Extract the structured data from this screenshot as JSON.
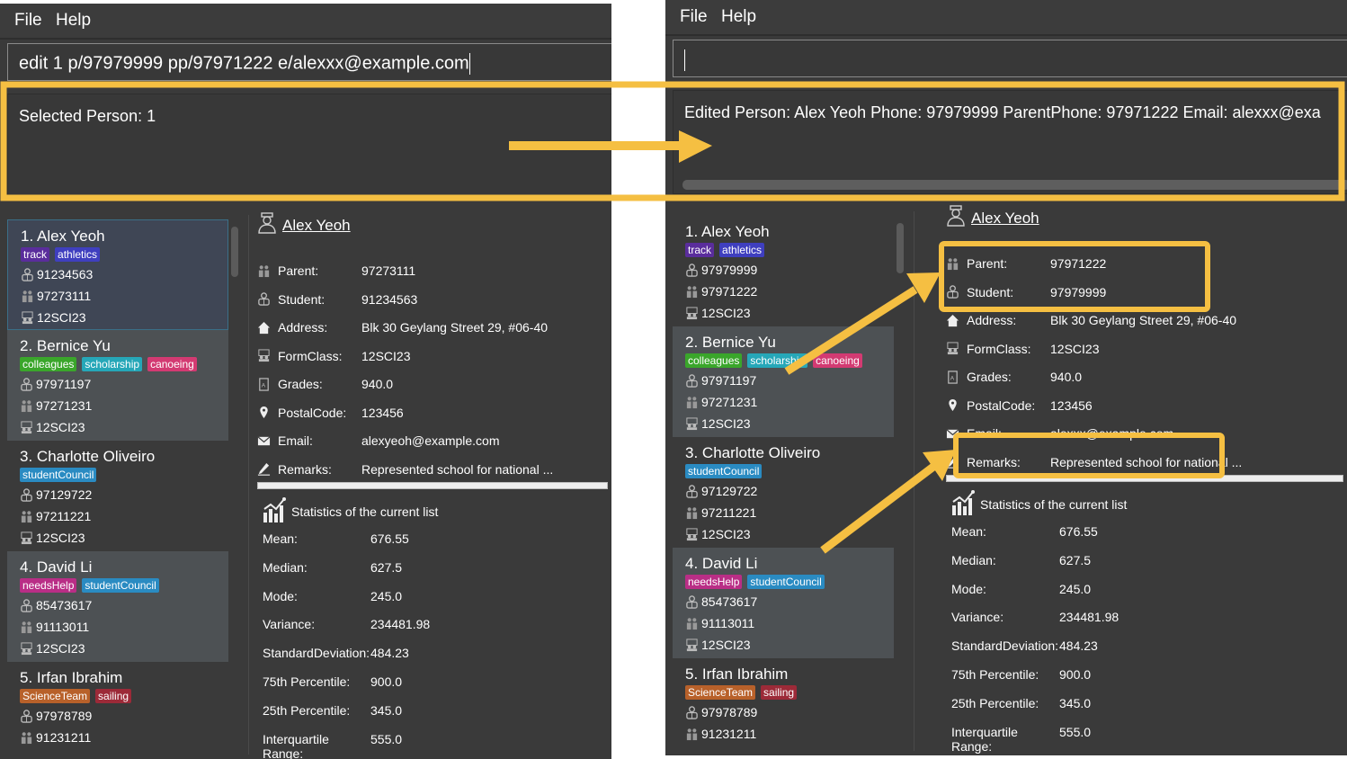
{
  "panels": [
    {
      "menu": [
        "File",
        "Help"
      ],
      "command": "edit 1 p/97979999 pp/97971222 e/alexxx@example.com",
      "result": "Selected Person: 1",
      "persons": [
        {
          "index": "1.",
          "name": "Alex Yeoh",
          "tags": [
            {
              "t": "track",
              "c": "#5a2d9c"
            },
            {
              "t": "athletics",
              "c": "#3f3fbf"
            }
          ],
          "student": "91234563",
          "parent": "97273111",
          "formclass": "12SCI23"
        },
        {
          "index": "2.",
          "name": "Bernice Yu",
          "tags": [
            {
              "t": "colleagues",
              "c": "#3aa62b"
            },
            {
              "t": "scholarship",
              "c": "#26a7b8"
            },
            {
              "t": "canoeing",
              "c": "#d33a72"
            }
          ],
          "student": "97971197",
          "parent": "97271231",
          "formclass": "12SCI23"
        },
        {
          "index": "3.",
          "name": "Charlotte Oliveiro",
          "tags": [
            {
              "t": "studentCouncil",
              "c": "#2a8bc2"
            }
          ],
          "student": "97129722",
          "parent": "97211221",
          "formclass": "12SCI23"
        },
        {
          "index": "4.",
          "name": "David Li",
          "tags": [
            {
              "t": "needsHelp",
              "c": "#b92e86"
            },
            {
              "t": "studentCouncil",
              "c": "#2a8bc2"
            }
          ],
          "student": "85473617",
          "parent": "91113011",
          "formclass": "12SCI23"
        },
        {
          "index": "5.",
          "name": "Irfan Ibrahim",
          "tags": [
            {
              "t": "ScienceTeam",
              "c": "#b8612a"
            },
            {
              "t": "sailing",
              "c": "#9c2a38"
            }
          ],
          "student": "97978789",
          "parent": "91231211",
          "formclass": ""
        }
      ],
      "detail": {
        "name": "Alex Yeoh",
        "rows": [
          {
            "label": "Parent:",
            "value": "97273111",
            "icon": "parent-icon"
          },
          {
            "label": "Student:",
            "value": "91234563",
            "icon": "student-icon"
          },
          {
            "label": "Address:",
            "value": "Blk 30 Geylang Street 29, #06-40",
            "icon": "home-icon"
          },
          {
            "label": "FormClass:",
            "value": "12SCI23",
            "icon": "class-icon"
          },
          {
            "label": "Grades:",
            "value": "940.0",
            "icon": "grades-icon"
          },
          {
            "label": "PostalCode:",
            "value": "123456",
            "icon": "pin-icon"
          },
          {
            "label": "Email:",
            "value": "alexyeoh@example.com",
            "icon": "email-icon"
          },
          {
            "label": "Remarks:",
            "value": "Represented school for national ...",
            "icon": "pencil-icon"
          }
        ]
      },
      "stats": {
        "title": "Statistics of the current list",
        "rows": [
          {
            "label": "Mean:",
            "value": "676.55"
          },
          {
            "label": "Median:",
            "value": "627.5"
          },
          {
            "label": "Mode:",
            "value": "245.0"
          },
          {
            "label": "Variance:",
            "value": "234481.98"
          },
          {
            "label": "StandardDeviation:",
            "value": "484.23"
          },
          {
            "label": "75th Percentile:",
            "value": "900.0"
          },
          {
            "label": "25th Percentile:",
            "value": "345.0"
          },
          {
            "label": "Interquartile Range:",
            "value": "555.0"
          }
        ]
      }
    },
    {
      "menu": [
        "File",
        "Help"
      ],
      "command": "",
      "result": "Edited Person: Alex Yeoh Phone: 97979999 ParentPhone: 97971222 Email: alexxx@exa",
      "persons": [
        {
          "index": "1.",
          "name": "Alex Yeoh",
          "tags": [
            {
              "t": "track",
              "c": "#5a2d9c"
            },
            {
              "t": "athletics",
              "c": "#3f3fbf"
            }
          ],
          "student": "97979999",
          "parent": "97971222",
          "formclass": "12SCI23"
        },
        {
          "index": "2.",
          "name": "Bernice Yu",
          "tags": [
            {
              "t": "colleagues",
              "c": "#3aa62b"
            },
            {
              "t": "scholarship",
              "c": "#26a7b8"
            },
            {
              "t": "canoeing",
              "c": "#d33a72"
            }
          ],
          "student": "97971197",
          "parent": "97271231",
          "formclass": "12SCI23"
        },
        {
          "index": "3.",
          "name": "Charlotte Oliveiro",
          "tags": [
            {
              "t": "studentCouncil",
              "c": "#2a8bc2"
            }
          ],
          "student": "97129722",
          "parent": "97211221",
          "formclass": "12SCI23"
        },
        {
          "index": "4.",
          "name": "David Li",
          "tags": [
            {
              "t": "needsHelp",
              "c": "#b92e86"
            },
            {
              "t": "studentCouncil",
              "c": "#2a8bc2"
            }
          ],
          "student": "85473617",
          "parent": "91113011",
          "formclass": "12SCI23"
        },
        {
          "index": "5.",
          "name": "Irfan Ibrahim",
          "tags": [
            {
              "t": "ScienceTeam",
              "c": "#b8612a"
            },
            {
              "t": "sailing",
              "c": "#9c2a38"
            }
          ],
          "student": "97978789",
          "parent": "91231211",
          "formclass": ""
        }
      ],
      "detail": {
        "name": "Alex Yeoh",
        "rows": [
          {
            "label": "Parent:",
            "value": "97971222",
            "icon": "parent-icon"
          },
          {
            "label": "Student:",
            "value": "97979999",
            "icon": "student-icon"
          },
          {
            "label": "Address:",
            "value": "Blk 30 Geylang Street 29, #06-40",
            "icon": "home-icon"
          },
          {
            "label": "FormClass:",
            "value": "12SCI23",
            "icon": "class-icon"
          },
          {
            "label": "Grades:",
            "value": "940.0",
            "icon": "grades-icon"
          },
          {
            "label": "PostalCode:",
            "value": "123456",
            "icon": "pin-icon"
          },
          {
            "label": "Email:",
            "value": "alexxx@example.com",
            "icon": "email-icon"
          },
          {
            "label": "Remarks:",
            "value": "Represented school for national ...",
            "icon": "pencil-icon"
          }
        ]
      },
      "stats": {
        "title": "Statistics of the current list",
        "rows": [
          {
            "label": "Mean:",
            "value": "676.55"
          },
          {
            "label": "Median:",
            "value": "627.5"
          },
          {
            "label": "Mode:",
            "value": "245.0"
          },
          {
            "label": "Variance:",
            "value": "234481.98"
          },
          {
            "label": "StandardDeviation:",
            "value": "484.23"
          },
          {
            "label": "75th Percentile:",
            "value": "900.0"
          },
          {
            "label": "25th Percentile:",
            "value": "345.0"
          },
          {
            "label": "Interquartile Range:",
            "value": "555.0"
          }
        ]
      }
    }
  ],
  "annotation_color": "#f5bf42"
}
